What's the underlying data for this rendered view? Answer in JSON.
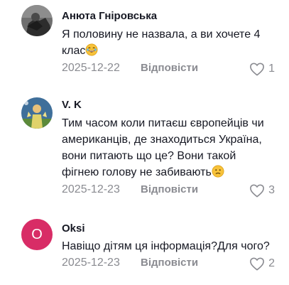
{
  "comments": [
    {
      "username": "Анюта Гніровська",
      "text": "Я половину не назвала, а ви хочете 4 клас",
      "emoji": "laughing-emoji",
      "date": "2025-12-22",
      "reply_label": "Відповісти",
      "likes": "1",
      "avatar": "photo"
    },
    {
      "username": "V. K",
      "text": "Тим часом коли питаєш європейців чи американців, де знаходиться Україна, вони питають що це? Вони такой фігнею голову не забивають",
      "emoji": "confused-emoji",
      "date": "2025-12-23",
      "reply_label": "Відповісти",
      "likes": "3",
      "avatar": "photo"
    },
    {
      "username": "Oksi",
      "text": "Навіщо дітям ця інформація?Для чого?",
      "date": "2025-12-23",
      "reply_label": "Відповісти",
      "likes": "2",
      "avatar_letter": "O",
      "avatar_color": "#d82c66"
    }
  ],
  "colors": {
    "text": "#161823",
    "muted": "#8a8b91",
    "avatar_oksi": "#d82c66"
  }
}
